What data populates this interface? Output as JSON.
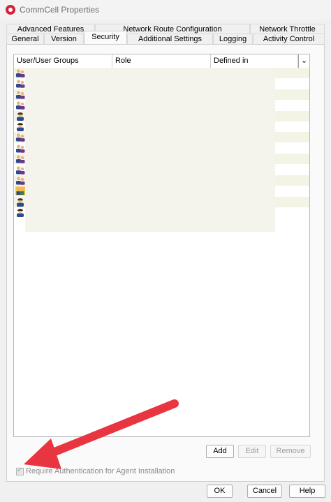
{
  "window": {
    "title": "CommCell Properties"
  },
  "tabs_row1": [
    {
      "label": "Advanced Features"
    },
    {
      "label": "Network Route Configuration"
    },
    {
      "label": "Network Throttle"
    }
  ],
  "tabs_row2": [
    {
      "label": "General"
    },
    {
      "label": "Version"
    },
    {
      "label": "Security",
      "active": true
    },
    {
      "label": "Additional Settings"
    },
    {
      "label": "Logging"
    },
    {
      "label": "Activity Control"
    }
  ],
  "table": {
    "columns": [
      "User/User Groups",
      "Role",
      "Defined in"
    ],
    "column_menu_icon": "chevron-down-icon",
    "row_icons": [
      "user-group-icon",
      "user-group-icon",
      "user-group-icon",
      "user-group-icon",
      "user-icon",
      "user-icon",
      "user-group-icon",
      "user-group-icon",
      "user-group-icon",
      "user-group-icon",
      "user-group-icon",
      "all-users-group-icon",
      "user-icon",
      "user-icon"
    ]
  },
  "buttons": {
    "add": "Add",
    "edit": "Edit",
    "remove": "Remove"
  },
  "checkbox": {
    "label": "Require Authentication for Agent Installation",
    "checked": true,
    "enabled": false
  },
  "footer": {
    "ok": "OK",
    "cancel": "Cancel",
    "help": "Help"
  },
  "annotation": {
    "arrow_color": "#e8353f"
  }
}
